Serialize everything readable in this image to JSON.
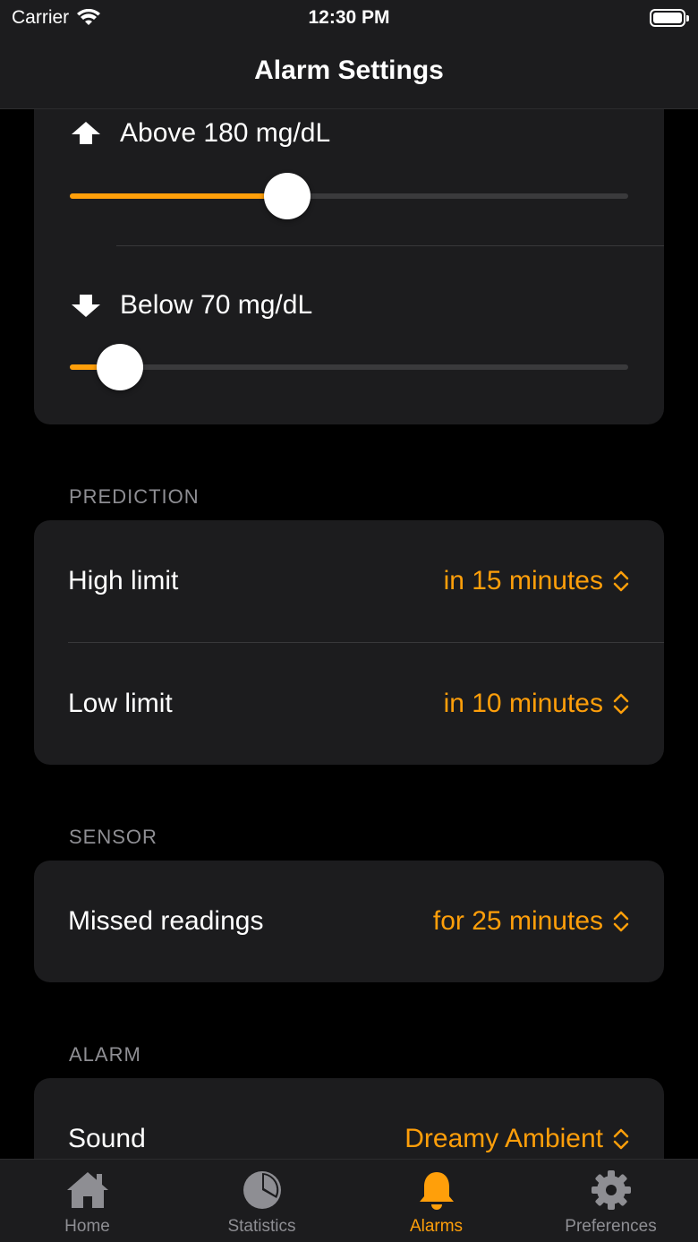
{
  "status_bar": {
    "carrier": "Carrier",
    "time": "12:30 PM"
  },
  "nav": {
    "title": "Alarm Settings"
  },
  "thresholds": {
    "high": {
      "label": "Above 180 mg/dL",
      "value_fraction": 0.39
    },
    "low": {
      "label": "Below 70 mg/dL",
      "value_fraction": 0.09
    }
  },
  "prediction": {
    "header": "PREDICTION",
    "high": {
      "label": "High limit",
      "value": "in 15 minutes"
    },
    "low": {
      "label": "Low limit",
      "value": "in 10 minutes"
    }
  },
  "sensor": {
    "header": "SENSOR",
    "missed": {
      "label": "Missed readings",
      "value": "for 25 minutes"
    }
  },
  "alarm": {
    "header": "ALARM",
    "sound": {
      "label": "Sound",
      "value": "Dreamy Ambient"
    }
  },
  "tabs": [
    {
      "label": "Home",
      "icon": "house-icon"
    },
    {
      "label": "Statistics",
      "icon": "pie-chart-icon"
    },
    {
      "label": "Alarms",
      "icon": "bell-icon",
      "active": true
    },
    {
      "label": "Preferences",
      "icon": "gear-icon"
    }
  ],
  "colors": {
    "accent": "#ff9f0a",
    "card": "#1c1c1e",
    "background": "#000000",
    "secondary_text": "#8e8e93"
  }
}
